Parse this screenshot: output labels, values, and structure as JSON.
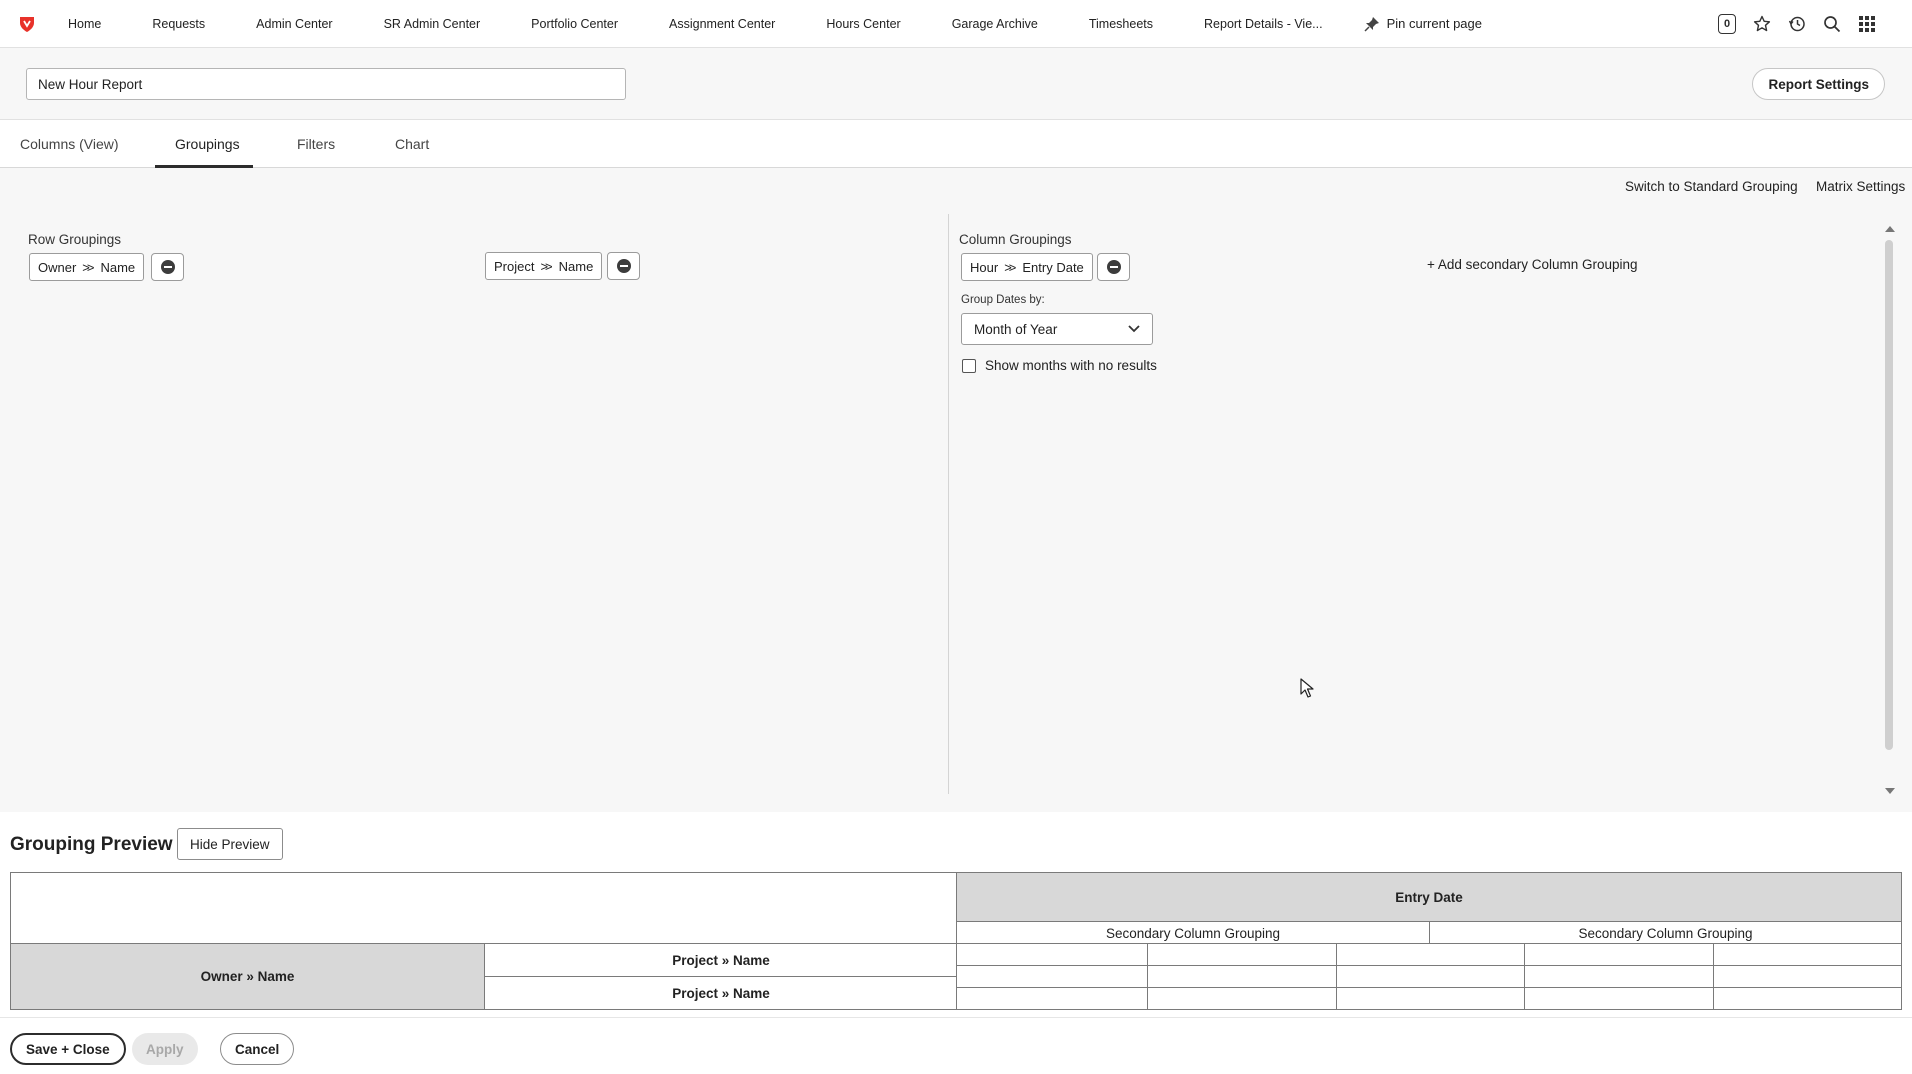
{
  "nav": {
    "items": [
      "Home",
      "Requests",
      "Admin Center",
      "SR Admin Center",
      "Portfolio Center",
      "Assignment Center",
      "Hours Center",
      "Garage Archive",
      "Timesheets",
      "Report Details - Vie..."
    ],
    "pin_label": "Pin current page",
    "badge_count": "0",
    "icons": [
      "notification-badge-icon",
      "star-icon",
      "history-icon",
      "search-icon",
      "apps-grid-icon"
    ]
  },
  "report": {
    "name": "New Hour Report",
    "settings_label": "Report Settings"
  },
  "tabs": [
    {
      "label": "Columns (View)",
      "active": false
    },
    {
      "label": "Groupings",
      "active": true
    },
    {
      "label": "Filters",
      "active": false
    },
    {
      "label": "Chart",
      "active": false
    }
  ],
  "groupings": {
    "switch_label": "Switch to Standard Grouping",
    "matrix_label": "Matrix Settings",
    "row_label": "Row Groupings",
    "row_primary": {
      "object": "Owner",
      "field": "Name"
    },
    "row_secondary": {
      "object": "Project",
      "field": "Name"
    },
    "column_label": "Column Groupings",
    "column_primary": {
      "object": "Hour",
      "field": "Entry Date"
    },
    "group_dates_label": "Group Dates by:",
    "group_dates_value": "Month of Year",
    "show_months_label": "Show months with no results",
    "show_months_checked": false,
    "add_secondary_label": "+ Add secondary Column Grouping"
  },
  "preview": {
    "title": "Grouping Preview",
    "hide_label": "Hide Preview",
    "column_header": "Entry Date",
    "secondary_header": "Secondary Column Grouping",
    "row_primary": "Owner » Name",
    "row_secondary": "Project » Name"
  },
  "footer": {
    "save_close": "Save + Close",
    "apply": "Apply",
    "cancel": "Cancel"
  },
  "colors": {
    "brand": "#e8322a",
    "header_gray": "#d8d8d8"
  }
}
